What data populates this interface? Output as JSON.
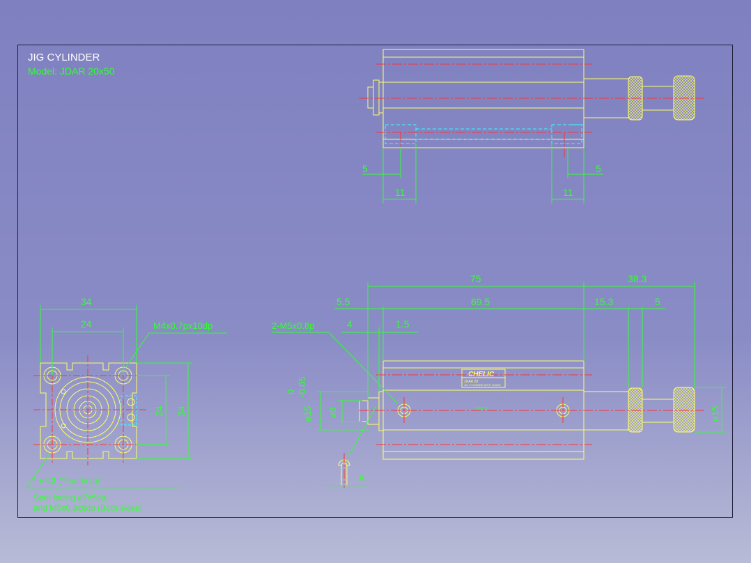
{
  "title": "JIG CYLINDER",
  "model": "Model:  JDAR 20x50",
  "colors": {
    "background": "#7f80c0",
    "outline": "#ffff66",
    "dimension": "#33ff33",
    "centerline": "#ff3333",
    "hidden": "#33ffff",
    "frame": "#20203a"
  },
  "top_view": {
    "dims": {
      "left_small": "5",
      "left_width": "11",
      "right_width": "11",
      "right_small": "5"
    }
  },
  "front_view": {
    "dims": {
      "overall": "34",
      "hole_pitch_h": "24",
      "hole_pitch_v": "24",
      "overall_v": "34"
    },
    "callout_thread": "M4x0.7px10dp",
    "note_line1": "4-ø4.3 (Thru-hole)",
    "note_line2": "Spot facing ø7x5dp,",
    "note_line3": "and M5x0.8x6dp (Both sides)"
  },
  "side_view": {
    "dims": {
      "body_length": "75",
      "rod_extension": "38.3",
      "front_offset": "5.5",
      "port_span": "69.5",
      "rod_to_knob": "15.3",
      "knob_width": "5",
      "port_to_front": "4",
      "port_offset": "1.5",
      "tolerance_top": "0",
      "tolerance_bottom": "-0.05",
      "rod_dia_tol": "ø15",
      "shaft_dia": "ø8",
      "knob_dia": "ø15",
      "bottom_gap": "6"
    },
    "port_callout": "2-M5x0.8p",
    "brand_label": "CHELIC",
    "label_line1": "JDAR 20",
    "label_line2": "JIG CYLINDER WITH GUIDE",
    "small_text": "JDAR 20"
  }
}
